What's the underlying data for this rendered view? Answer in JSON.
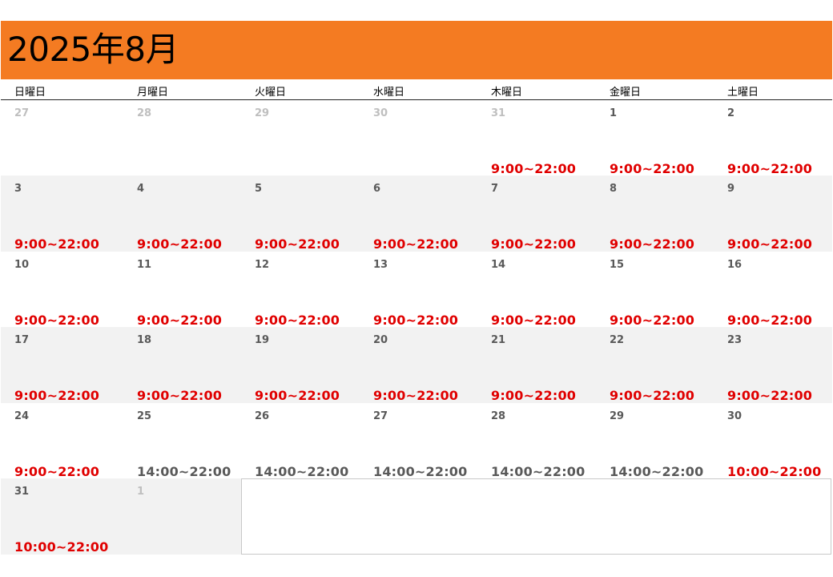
{
  "title": "2025年8月",
  "weekdays": [
    "日曜日",
    "月曜日",
    "火曜日",
    "水曜日",
    "木曜日",
    "金曜日",
    "土曜日"
  ],
  "colors": {
    "header_orange": "#f47b22",
    "hours_red": "#e00000",
    "hours_gray": "#595959",
    "other_month_day": "#bfbfbf",
    "shaded_row": "#f2f2f2"
  },
  "weeks": [
    [
      {
        "day": "27",
        "other": true,
        "hours": ""
      },
      {
        "day": "28",
        "other": true,
        "hours": ""
      },
      {
        "day": "29",
        "other": true,
        "hours": ""
      },
      {
        "day": "30",
        "other": true,
        "hours": ""
      },
      {
        "day": "31",
        "other": true,
        "hours": "9:00~22:00",
        "color": "red"
      },
      {
        "day": "1",
        "hours": "9:00~22:00",
        "color": "red"
      },
      {
        "day": "2",
        "hours": "9:00~22:00",
        "color": "red"
      }
    ],
    [
      {
        "day": "3",
        "hours": "9:00~22:00",
        "color": "red"
      },
      {
        "day": "4",
        "hours": "9:00~22:00",
        "color": "red"
      },
      {
        "day": "5",
        "hours": "9:00~22:00",
        "color": "red"
      },
      {
        "day": "6",
        "hours": "9:00~22:00",
        "color": "red"
      },
      {
        "day": "7",
        "hours": "9:00~22:00",
        "color": "red"
      },
      {
        "day": "8",
        "hours": "9:00~22:00",
        "color": "red"
      },
      {
        "day": "9",
        "hours": "9:00~22:00",
        "color": "red"
      }
    ],
    [
      {
        "day": "10",
        "hours": "9:00~22:00",
        "color": "red"
      },
      {
        "day": "11",
        "hours": "9:00~22:00",
        "color": "red"
      },
      {
        "day": "12",
        "hours": "9:00~22:00",
        "color": "red"
      },
      {
        "day": "13",
        "hours": "9:00~22:00",
        "color": "red"
      },
      {
        "day": "14",
        "hours": "9:00~22:00",
        "color": "red"
      },
      {
        "day": "15",
        "hours": "9:00~22:00",
        "color": "red"
      },
      {
        "day": "16",
        "hours": "9:00~22:00",
        "color": "red"
      }
    ],
    [
      {
        "day": "17",
        "hours": "9:00~22:00",
        "color": "red"
      },
      {
        "day": "18",
        "hours": "9:00~22:00",
        "color": "red"
      },
      {
        "day": "19",
        "hours": "9:00~22:00",
        "color": "red"
      },
      {
        "day": "20",
        "hours": "9:00~22:00",
        "color": "red"
      },
      {
        "day": "21",
        "hours": "9:00~22:00",
        "color": "red"
      },
      {
        "day": "22",
        "hours": "9:00~22:00",
        "color": "red"
      },
      {
        "day": "23",
        "hours": "9:00~22:00",
        "color": "red"
      }
    ],
    [
      {
        "day": "24",
        "hours": "9:00~22:00",
        "color": "red"
      },
      {
        "day": "25",
        "hours": "14:00~22:00",
        "color": "gray"
      },
      {
        "day": "26",
        "hours": "14:00~22:00",
        "color": "gray"
      },
      {
        "day": "27",
        "hours": "14:00~22:00",
        "color": "gray"
      },
      {
        "day": "28",
        "hours": "14:00~22:00",
        "color": "gray"
      },
      {
        "day": "29",
        "hours": "14:00~22:00",
        "color": "gray"
      },
      {
        "day": "30",
        "hours": "10:00~22:00",
        "color": "red"
      }
    ],
    [
      {
        "day": "31",
        "hours": "10:00~22:00",
        "color": "red"
      },
      {
        "day": "1",
        "other": true,
        "hours": ""
      }
    ]
  ]
}
